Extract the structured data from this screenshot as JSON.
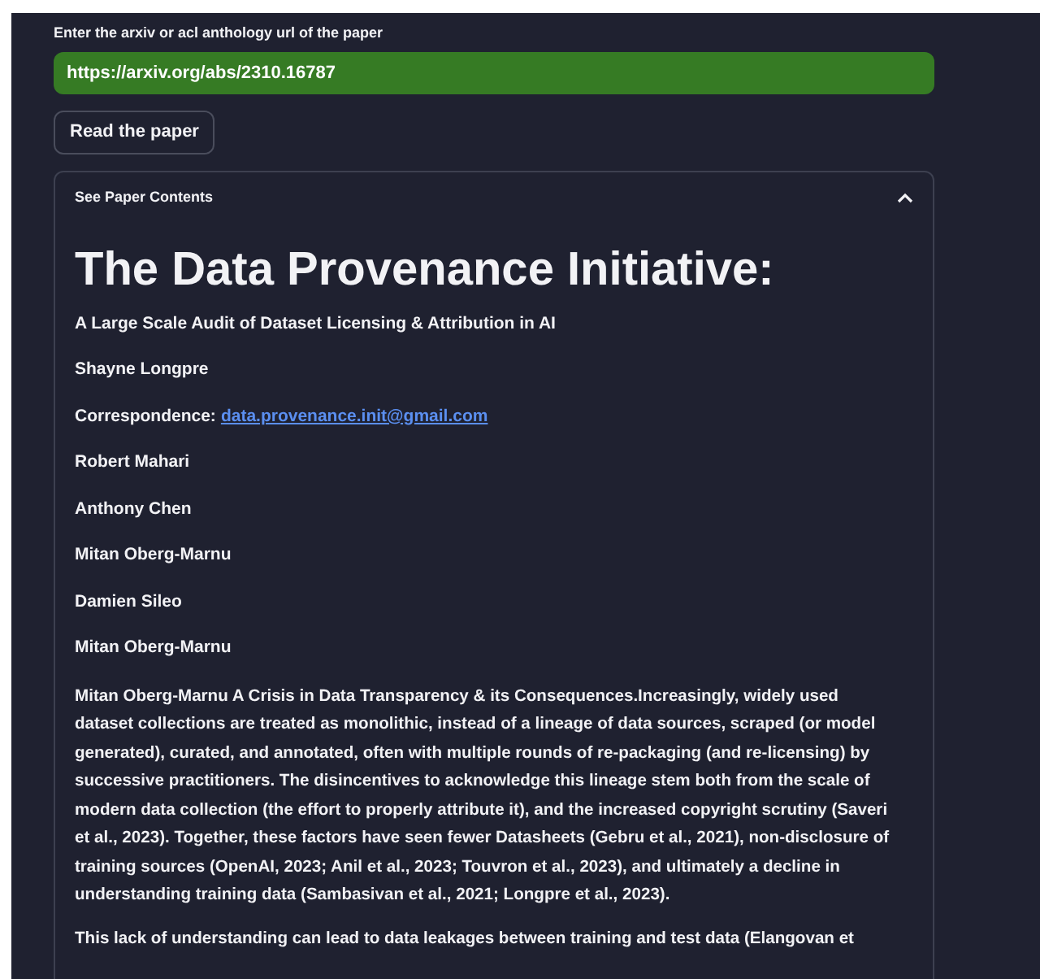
{
  "url_field": {
    "label": "Enter the arxiv or acl anthology url of the paper",
    "value": "https://arxiv.org/abs/2310.16787"
  },
  "read_button": "Read the paper",
  "expander": {
    "title": "See Paper Contents",
    "expanded": true
  },
  "paper": {
    "title": "The Data Provenance Initiative:",
    "lines": [
      {
        "text": "A Large Scale Audit of Dataset Licensing & Attribution in AI"
      },
      {
        "text": "Shayne Longpre"
      },
      {
        "text": "Correspondence:",
        "link": "data.provenance.init@gmail.com"
      },
      {
        "text": "Robert Mahari"
      },
      {
        "text": "Anthony Chen"
      },
      {
        "text": "Mitan Oberg-Marnu"
      },
      {
        "text": "Damien Sileo"
      },
      {
        "text": "Mitan Oberg-Marnu"
      }
    ],
    "paragraphs": [
      "Mitan Oberg-Marnu A Crisis in Data Transparency & its Consequences.Increasingly, widely used dataset collections are treated as monolithic, instead of a lineage of data sources, scraped (or model generated), curated, and annotated, often with multiple rounds of re-packaging (and re-licensing) by successive practitioners. The disincentives to acknowledge this lineage stem both from the scale of modern data collection (the effort to properly attribute it), and the increased copyright scrutiny (Saveri et al., 2023). Together, these factors have seen fewer Datasheets (Gebru et al., 2021), non-disclosure of training sources (OpenAI, 2023; Anil et al., 2023; Touvron et al., 2023), and ultimately a decline in understanding training data (Sambasivan et al., 2021; Longpre et al., 2023).",
      "This lack of understanding can lead to data leakages between training and test data (Elangovan et"
    ]
  }
}
